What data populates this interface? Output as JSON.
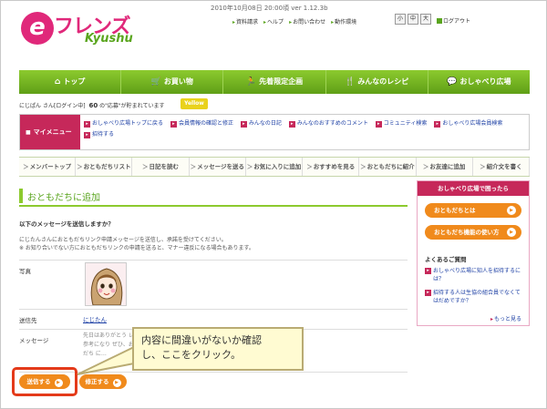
{
  "header": {
    "logo_e": "e",
    "logo_friends": "フレンズ",
    "logo_kyushu": "Kyushu",
    "datever": "2010年10月08日 20:00頃 ver 1.12.3b",
    "top_links": [
      "資料請求",
      "ヘルプ",
      "お問い合わせ",
      "動作環境"
    ],
    "font_sizes": [
      "小",
      "中",
      "大"
    ],
    "logout": "ログアウト"
  },
  "nav": {
    "items": [
      {
        "icon": "house-icon",
        "glyph": "⌂",
        "label": "トップ"
      },
      {
        "icon": "cart-icon",
        "glyph": "🛒",
        "label": "お買い物"
      },
      {
        "icon": "runner-icon",
        "glyph": "🏃",
        "label": "先着限定企画"
      },
      {
        "icon": "cutlery-icon",
        "glyph": "🍴",
        "label": "みんなのレシピ"
      },
      {
        "icon": "chat-bubble-icon",
        "glyph": "💬",
        "label": "おしゃべり広場"
      }
    ]
  },
  "user": {
    "name": "にじぱん",
    "suffix": "さん[ログイン中]",
    "points": "60",
    "note": "の\"応募\"が貯まれています",
    "rank": "Yellow"
  },
  "mymenu": {
    "label": "マイメニュー",
    "links": [
      "おしゃべり広場トップに戻る",
      "会員情報の確認と修正",
      "みんなの日記",
      "みんなのおすすめのコメント",
      "コミュニティ検索",
      "おしゃべり広場会員検索",
      "招待する"
    ]
  },
  "submenu": [
    "メンバートップ",
    "おともだちリスト",
    "日記を読む",
    "メッセージを送る",
    "お気に入りに追加",
    "おすすめを見る",
    "おともだちに紹介",
    "お友達に追加",
    "紹介文を書く"
  ],
  "main": {
    "title": "おともだちに追加",
    "question": "以下のメッセージを送信しますか？",
    "desc1": "にじたんさんにおともだちリンク申請メッセージを送信し、承諾を受けてください。",
    "desc2": "※ お知り合いでない方におともだちリンクの申請を送ると、マナー違反になる場合もあります。",
    "photo_label": "写真",
    "to_label": "送信先",
    "to_value": "にじたん",
    "message_label": "メッセージ",
    "message_text": "先日はありがとう レシピ参考になり ぜひ、おともだち に…"
  },
  "buttons": {
    "send": "送信する",
    "fix": "修正する"
  },
  "callout": {
    "line1": "内容に間違いがないか確認",
    "line2": "し、ここをクリック。"
  },
  "sidebar": {
    "heading": "おしゃべり広場で困ったら",
    "btn1": "おともだちとは",
    "btn2": "おともだち機能の使い方",
    "faq_title": "よくあるご質問",
    "faq1": "おしゃべり広場に知人を招待するには？",
    "faq2": "招待する人は生協の組合員でなくてはだめですか？",
    "more": "もっと見る"
  },
  "colors": {
    "nav_green": "#8cca2e",
    "brand_pink": "#c6285a",
    "button_orange": "#f08a1c",
    "highlight_red": "#e43a1a",
    "callout_bg": "#fffbd2",
    "rank_yellow": "#e9d21c"
  }
}
